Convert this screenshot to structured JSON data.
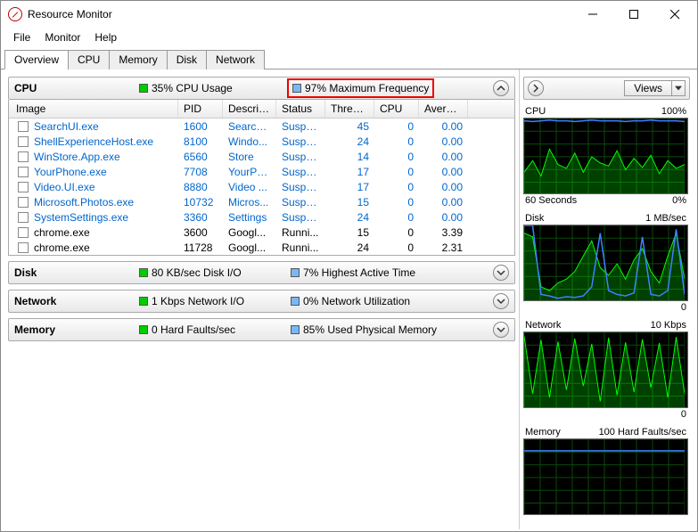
{
  "window": {
    "title": "Resource Monitor"
  },
  "menu": [
    "File",
    "Monitor",
    "Help"
  ],
  "tabs": [
    "Overview",
    "CPU",
    "Memory",
    "Disk",
    "Network"
  ],
  "activeTab": 0,
  "sections": {
    "cpu": {
      "title": "CPU",
      "stat1": "35% CPU Usage",
      "stat2": "97% Maximum Frequency",
      "columns": [
        "Image",
        "PID",
        "Descrip...",
        "Status",
        "Threads",
        "CPU",
        "Averag..."
      ],
      "rows": [
        {
          "image": "SearchUI.exe",
          "pid": "1600",
          "desc": "Search ...",
          "status": "Suspe...",
          "threads": "45",
          "cpu": "0",
          "avg": "0.00",
          "susp": true
        },
        {
          "image": "ShellExperienceHost.exe",
          "pid": "8100",
          "desc": "Windo...",
          "status": "Suspe...",
          "threads": "24",
          "cpu": "0",
          "avg": "0.00",
          "susp": true
        },
        {
          "image": "WinStore.App.exe",
          "pid": "6560",
          "desc": "Store",
          "status": "Suspe...",
          "threads": "14",
          "cpu": "0",
          "avg": "0.00",
          "susp": true
        },
        {
          "image": "YourPhone.exe",
          "pid": "7708",
          "desc": "YourPh...",
          "status": "Suspe...",
          "threads": "17",
          "cpu": "0",
          "avg": "0.00",
          "susp": true
        },
        {
          "image": "Video.UI.exe",
          "pid": "8880",
          "desc": "Video ...",
          "status": "Suspe...",
          "threads": "17",
          "cpu": "0",
          "avg": "0.00",
          "susp": true
        },
        {
          "image": "Microsoft.Photos.exe",
          "pid": "10732",
          "desc": "Micros...",
          "status": "Suspe...",
          "threads": "15",
          "cpu": "0",
          "avg": "0.00",
          "susp": true
        },
        {
          "image": "SystemSettings.exe",
          "pid": "3360",
          "desc": "Settings",
          "status": "Suspe...",
          "threads": "24",
          "cpu": "0",
          "avg": "0.00",
          "susp": true
        },
        {
          "image": "chrome.exe",
          "pid": "3600",
          "desc": "Googl...",
          "status": "Runni...",
          "threads": "15",
          "cpu": "0",
          "avg": "3.39",
          "susp": false
        },
        {
          "image": "chrome.exe",
          "pid": "11728",
          "desc": "Googl...",
          "status": "Runni...",
          "threads": "24",
          "cpu": "0",
          "avg": "2.31",
          "susp": false
        }
      ]
    },
    "disk": {
      "title": "Disk",
      "stat1": "80 KB/sec Disk I/O",
      "stat2": "7% Highest Active Time"
    },
    "network": {
      "title": "Network",
      "stat1": "1 Kbps Network I/O",
      "stat2": "0% Network Utilization"
    },
    "memory": {
      "title": "Memory",
      "stat1": "0 Hard Faults/sec",
      "stat2": "85% Used Physical Memory"
    }
  },
  "rightPanel": {
    "viewsLabel": "Views",
    "graphs": [
      {
        "title": "CPU",
        "right": "100%",
        "footerLeft": "60 Seconds",
        "footerRight": "0%"
      },
      {
        "title": "Disk",
        "right": "1 MB/sec",
        "footerLeft": "",
        "footerRight": "0"
      },
      {
        "title": "Network",
        "right": "10 Kbps",
        "footerLeft": "",
        "footerRight": "0"
      },
      {
        "title": "Memory",
        "right": "100 Hard Faults/sec",
        "footerLeft": "",
        "footerRight": ""
      }
    ]
  },
  "chart_data": [
    {
      "type": "line",
      "title": "CPU",
      "ylim": [
        0,
        100
      ],
      "xlabel": "60 Seconds",
      "series": [
        {
          "name": "Maximum Frequency",
          "color": "#4080ff",
          "values": [
            97,
            96,
            97,
            98,
            97,
            97,
            96,
            97,
            98,
            97,
            97,
            97,
            96,
            97,
            97,
            98,
            97,
            97,
            97,
            96
          ]
        },
        {
          "name": "CPU Usage",
          "color": "#00ff00",
          "values": [
            30,
            45,
            25,
            60,
            40,
            35,
            55,
            30,
            50,
            42,
            38,
            58,
            33,
            48,
            36,
            52,
            28,
            45,
            35,
            40
          ]
        }
      ]
    },
    {
      "type": "line",
      "title": "Disk",
      "ylim": [
        0,
        1
      ],
      "ylabel": "MB/sec",
      "series": [
        {
          "name": "Highest Active Time",
          "color": "#4080ff",
          "values": [
            100,
            100,
            10,
            8,
            5,
            7,
            6,
            8,
            20,
            90,
            15,
            10,
            8,
            12,
            85,
            10,
            8,
            15,
            95,
            10
          ]
        },
        {
          "name": "Disk I/O",
          "color": "#00ff00",
          "values": [
            90,
            85,
            20,
            15,
            25,
            30,
            40,
            60,
            80,
            45,
            35,
            50,
            30,
            55,
            70,
            40,
            25,
            60,
            90,
            30
          ]
        }
      ]
    },
    {
      "type": "line",
      "title": "Network",
      "ylim": [
        0,
        10
      ],
      "ylabel": "Kbps",
      "series": [
        {
          "name": "Network Utilization",
          "color": "#4080ff",
          "values": [
            0,
            0,
            0,
            0,
            0,
            0,
            0,
            0,
            0,
            0,
            0,
            0,
            0,
            0,
            0,
            0,
            0,
            0,
            0,
            0
          ]
        },
        {
          "name": "Network I/O",
          "color": "#00ff00",
          "values": [
            95,
            20,
            90,
            15,
            88,
            25,
            92,
            30,
            85,
            10,
            93,
            18,
            87,
            22,
            91,
            28,
            86,
            15,
            94,
            20
          ]
        }
      ]
    },
    {
      "type": "line",
      "title": "Memory",
      "ylim": [
        0,
        100
      ],
      "ylabel": "Hard Faults/sec",
      "series": [
        {
          "name": "Used Physical Memory",
          "color": "#4080ff",
          "values": [
            85,
            85,
            85,
            85,
            85,
            85,
            85,
            85,
            85,
            85,
            85,
            85,
            85,
            85,
            85,
            85,
            85,
            85,
            85,
            85
          ]
        },
        {
          "name": "Hard Faults",
          "color": "#00ff00",
          "values": [
            0,
            0,
            0,
            0,
            0,
            0,
            0,
            0,
            0,
            0,
            0,
            0,
            0,
            0,
            0,
            0,
            0,
            0,
            0,
            0
          ]
        }
      ]
    }
  ]
}
